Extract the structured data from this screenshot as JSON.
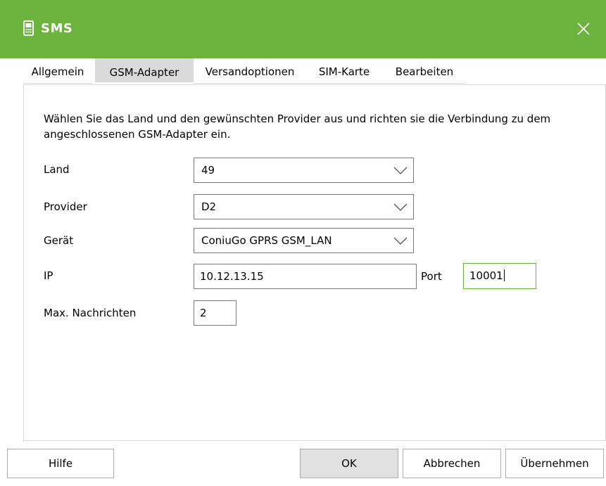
{
  "window": {
    "title": "SMS"
  },
  "tabs": [
    {
      "label": "Allgemein"
    },
    {
      "label": "GSM-Adapter",
      "active": true
    },
    {
      "label": "Versandoptionen"
    },
    {
      "label": "SIM-Karte"
    },
    {
      "label": "Bearbeiten"
    }
  ],
  "description": "Wählen Sie das Land und den gewünschten Provider aus und richten sie die Verbindung zu dem angeschlossenen GSM-Adapter ein.",
  "form": {
    "land": {
      "label": "Land",
      "value": "49"
    },
    "provider": {
      "label": "Provider",
      "value": "D2"
    },
    "geraet": {
      "label": "Gerät",
      "value": "ConiuGo GPRS GSM_LAN"
    },
    "ip": {
      "label": "IP",
      "value": "10.12.13.15"
    },
    "port": {
      "label": "Port",
      "value": "10001"
    },
    "max": {
      "label": "Max. Nachrichten",
      "value": "2"
    }
  },
  "buttons": {
    "help": "Hilfe",
    "ok": "OK",
    "cancel": "Abbrechen",
    "apply": "Übernehmen"
  },
  "colors": {
    "accent": "#6cb33e",
    "tab_active": "#dadada"
  },
  "icons": {
    "app": "mobile-phone-icon",
    "close": "close-icon",
    "dropdown": "chevron-down-icon"
  }
}
